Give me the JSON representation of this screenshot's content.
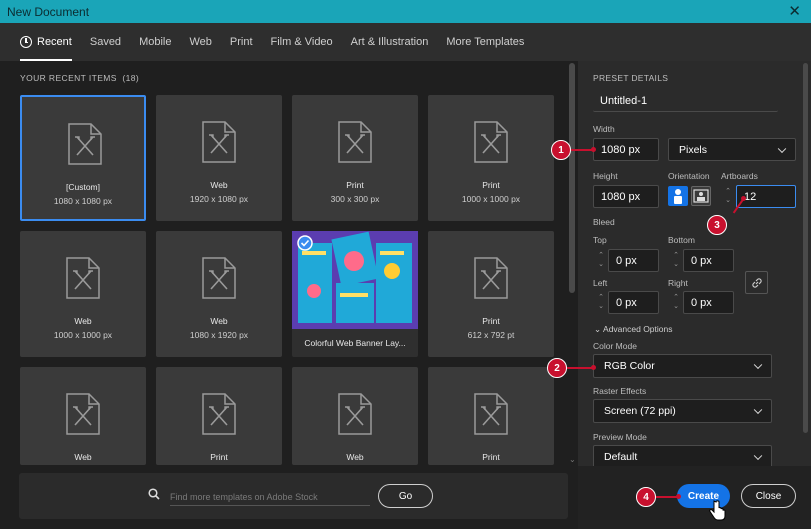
{
  "window": {
    "title": "New Document",
    "close": "✕"
  },
  "tabs": [
    "Recent",
    "Saved",
    "Mobile",
    "Web",
    "Print",
    "Film & Video",
    "Art & Illustration",
    "More Templates"
  ],
  "recent": {
    "heading": "YOUR RECENT ITEMS",
    "count": "(18)",
    "items": [
      {
        "name": "[Custom]",
        "size": "1080 x 1080 px"
      },
      {
        "name": "Web",
        "size": "1920 x 1080 px"
      },
      {
        "name": "Print",
        "size": "300 x 300 px"
      },
      {
        "name": "Print",
        "size": "1000 x 1000 px"
      },
      {
        "name": "Web",
        "size": "1000 x 1000 px"
      },
      {
        "name": "Web",
        "size": "1080 x 1920 px"
      },
      {
        "name": "Colorful Web Banner Lay...",
        "size": ""
      },
      {
        "name": "Print",
        "size": "612 x 792 pt"
      },
      {
        "name": "Web",
        "size": ""
      },
      {
        "name": "Print",
        "size": ""
      },
      {
        "name": "Web",
        "size": ""
      },
      {
        "name": "Print",
        "size": ""
      }
    ]
  },
  "search": {
    "placeholder": "Find more templates on Adobe Stock",
    "go": "Go"
  },
  "preset": {
    "heading": "PRESET DETAILS",
    "name": "Untitled-1",
    "width_label": "Width",
    "width": "1080 px",
    "unit": "Pixels",
    "height_label": "Height",
    "height": "1080 px",
    "orientation_label": "Orientation",
    "artboards_label": "Artboards",
    "artboards": "12",
    "bleed_label": "Bleed",
    "top_label": "Top",
    "top": "0 px",
    "bottom_label": "Bottom",
    "bottom": "0 px",
    "left_label": "Left",
    "left": "0 px",
    "right_label": "Right",
    "right": "0 px",
    "advanced": "Advanced Options",
    "color_mode_label": "Color Mode",
    "color_mode": "RGB Color",
    "raster_label": "Raster Effects",
    "raster": "Screen (72 ppi)",
    "preview_label": "Preview Mode",
    "preview": "Default"
  },
  "buttons": {
    "create": "Create",
    "close": "Close"
  },
  "markers": [
    "1",
    "2",
    "3",
    "4"
  ],
  "colors": {
    "accent": "#1473e6",
    "titlebar": "#1aa5b8",
    "marker": "#c8102e"
  }
}
